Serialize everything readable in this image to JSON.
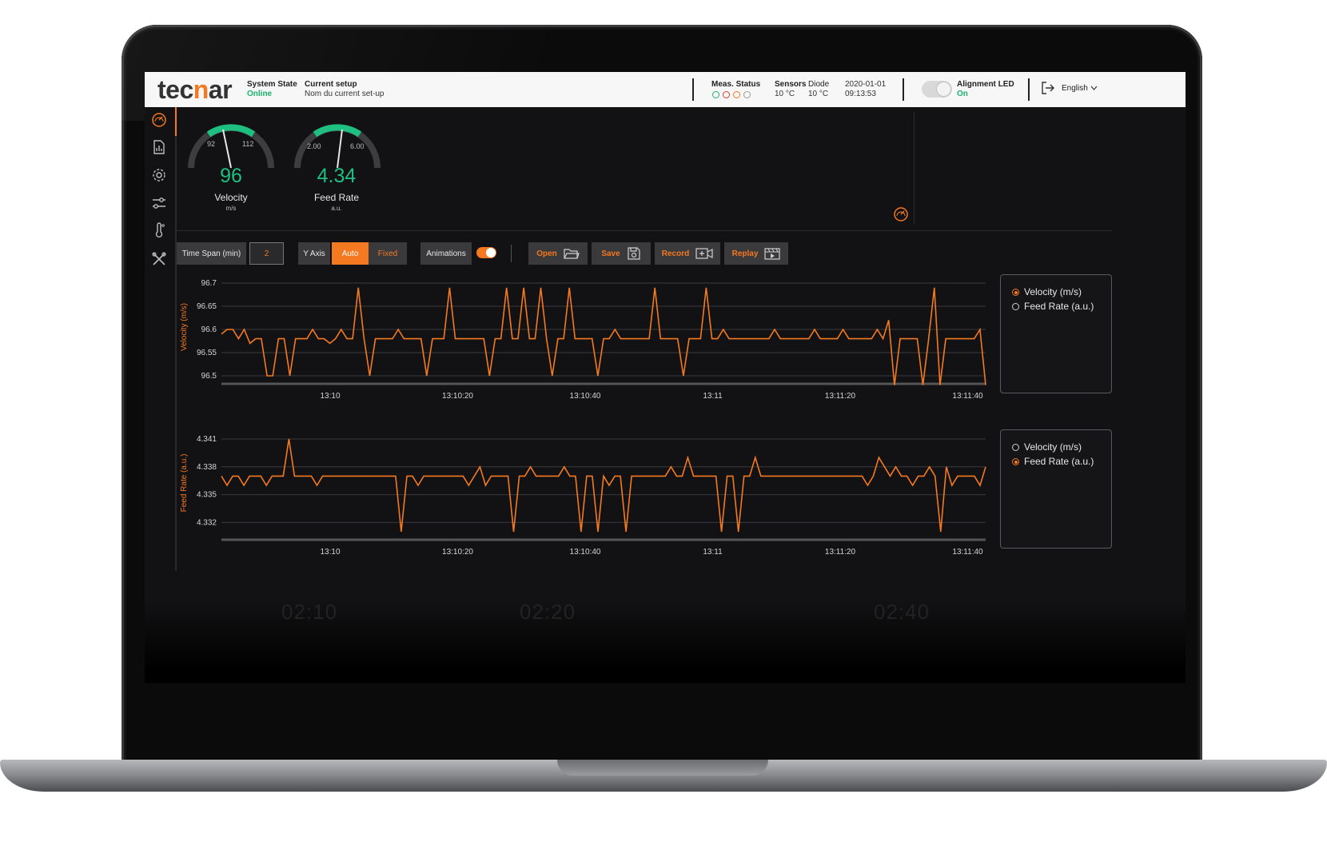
{
  "header": {
    "logo_prefix": "tec",
    "logo_accent": "n",
    "logo_suffix": "ar",
    "system_state_label": "System State",
    "system_state_value": "Online",
    "current_setup_label": "Current setup",
    "current_setup_value": "Nom du current set-up",
    "meas_status_label": "Meas. Status",
    "sensors_label": "Sensors",
    "sensors_value": "10 °C",
    "diode_label": "Diode",
    "diode_value": "10 °C",
    "date": "2020-01-01",
    "time": "09:13:53",
    "alignment_label": "Alignment LED",
    "alignment_value": "On",
    "language": "English",
    "status_dot_colors": [
      "#1bb26b",
      "#e23b2e",
      "#f47920",
      "#9a9a9a"
    ]
  },
  "sidebar": {
    "icons": [
      "gauge-icon",
      "report-icon",
      "gear-icon",
      "sliders-icon",
      "thermometer-icon",
      "tools-icon"
    ]
  },
  "gauges": [
    {
      "value": "96",
      "label": "Velocity",
      "unit": "m/s",
      "min_tick": "92",
      "max_tick": "112"
    },
    {
      "value": "4.34",
      "label": "Feed Rate",
      "unit": "a.u.",
      "min_tick": "2.00",
      "max_tick": "6.00"
    }
  ],
  "toolbar": {
    "time_span_label": "Time Span (min)",
    "time_span_value": "2",
    "y_axis_label": "Y Axis",
    "auto_label": "Auto",
    "fixed_label": "Fixed",
    "animations_label": "Animations",
    "open_label": "Open",
    "save_label": "Save",
    "record_label": "Record",
    "replay_label": "Replay"
  },
  "legend_top": {
    "items": [
      {
        "label": "Velocity (m/s)",
        "selected": true
      },
      {
        "label": "Feed Rate (a.u.)",
        "selected": false
      }
    ]
  },
  "legend_bottom": {
    "items": [
      {
        "label": "Velocity (m/s)",
        "selected": false
      },
      {
        "label": "Feed Rate (a.u.)",
        "selected": true
      }
    ]
  },
  "ghost_times": [
    "02:10",
    "02:20",
    "02:40"
  ],
  "colors": {
    "accent": "#f47920",
    "good": "#1bb26b",
    "background": "#121214"
  },
  "chart_data": [
    {
      "type": "line",
      "ylabel": "Velocity (m/s)",
      "ylim": [
        96.5,
        96.7
      ],
      "yticks": [
        "96.7",
        "96.65",
        "96.6",
        "96.55",
        "96.5"
      ],
      "xticks": [
        "13:10",
        "13:10:20",
        "13:10:40",
        "13:11",
        "13:11:20",
        "13:11:40"
      ],
      "series": [
        {
          "name": "Velocity (m/s)",
          "values": [
            96.59,
            96.6,
            96.6,
            96.58,
            96.6,
            96.57,
            96.58,
            96.58,
            96.5,
            96.5,
            96.58,
            96.58,
            96.5,
            96.58,
            96.58,
            96.58,
            96.6,
            96.58,
            96.58,
            96.57,
            96.58,
            96.6,
            96.58,
            96.58,
            96.69,
            96.58,
            96.5,
            96.58,
            96.58,
            96.58,
            96.58,
            96.6,
            96.58,
            96.58,
            96.58,
            96.58,
            96.5,
            96.58,
            96.58,
            96.58,
            96.69,
            96.58,
            96.58,
            96.58,
            96.58,
            96.58,
            96.58,
            96.5,
            96.58,
            96.58,
            96.69,
            96.58,
            96.58,
            96.69,
            96.58,
            96.58,
            96.69,
            96.58,
            96.5,
            96.58,
            96.58,
            96.69,
            96.58,
            96.58,
            96.58,
            96.58,
            96.5,
            96.58,
            96.58,
            96.6,
            96.58,
            96.58,
            96.58,
            96.58,
            96.58,
            96.58,
            96.69,
            96.58,
            96.58,
            96.58,
            96.58,
            96.5,
            96.58,
            96.58,
            96.58,
            96.69,
            96.58,
            96.58,
            96.6,
            96.58,
            96.58,
            96.58,
            96.58,
            96.58,
            96.58,
            96.58,
            96.58,
            96.6,
            96.58,
            96.58,
            96.58,
            96.58,
            96.58,
            96.58,
            96.6,
            96.58,
            96.58,
            96.58,
            96.58,
            96.6,
            96.58,
            96.58,
            96.58,
            96.58,
            96.58,
            96.6,
            96.58,
            96.62,
            96.48,
            96.58,
            96.58,
            96.58,
            96.58,
            96.48,
            96.58,
            96.69,
            96.48,
            96.58,
            96.58,
            96.58,
            96.58,
            96.58,
            96.58,
            96.6,
            96.48
          ]
        }
      ]
    },
    {
      "type": "line",
      "ylabel": "Feed Rate (a.u.)",
      "ylim": [
        4.331,
        4.341
      ],
      "yticks": [
        "4.341",
        "4.338",
        "4.335",
        "4.332"
      ],
      "xticks": [
        "13:10",
        "13:10:20",
        "13:10:40",
        "13:11",
        "13:11:20",
        "13:11:40"
      ],
      "series": [
        {
          "name": "Feed Rate (a.u.)",
          "values": [
            4.337,
            4.336,
            4.337,
            4.337,
            4.336,
            4.337,
            4.337,
            4.337,
            4.336,
            4.337,
            4.337,
            4.337,
            4.341,
            4.337,
            4.337,
            4.337,
            4.337,
            4.336,
            4.337,
            4.337,
            4.337,
            4.337,
            4.337,
            4.337,
            4.337,
            4.337,
            4.337,
            4.337,
            4.337,
            4.337,
            4.337,
            4.337,
            4.331,
            4.337,
            4.337,
            4.336,
            4.337,
            4.337,
            4.337,
            4.337,
            4.337,
            4.337,
            4.337,
            4.337,
            4.336,
            4.337,
            4.338,
            4.336,
            4.337,
            4.337,
            4.337,
            4.337,
            4.331,
            4.337,
            4.337,
            4.338,
            4.337,
            4.337,
            4.337,
            4.337,
            4.337,
            4.338,
            4.337,
            4.337,
            4.331,
            4.337,
            4.337,
            4.331,
            4.337,
            4.336,
            4.337,
            4.337,
            4.331,
            4.337,
            4.337,
            4.337,
            4.337,
            4.337,
            4.337,
            4.337,
            4.338,
            4.337,
            4.337,
            4.339,
            4.337,
            4.337,
            4.337,
            4.337,
            4.337,
            4.331,
            4.337,
            4.337,
            4.331,
            4.337,
            4.337,
            4.339,
            4.337,
            4.337,
            4.337,
            4.337,
            4.337,
            4.337,
            4.337,
            4.337,
            4.337,
            4.337,
            4.337,
            4.337,
            4.337,
            4.337,
            4.337,
            4.337,
            4.337,
            4.337,
            4.337,
            4.336,
            4.337,
            4.339,
            4.338,
            4.337,
            4.338,
            4.337,
            4.337,
            4.336,
            4.337,
            4.337,
            4.338,
            4.337,
            4.331,
            4.338,
            4.336,
            4.337,
            4.337,
            4.337,
            4.337,
            4.336,
            4.338
          ]
        }
      ]
    }
  ]
}
